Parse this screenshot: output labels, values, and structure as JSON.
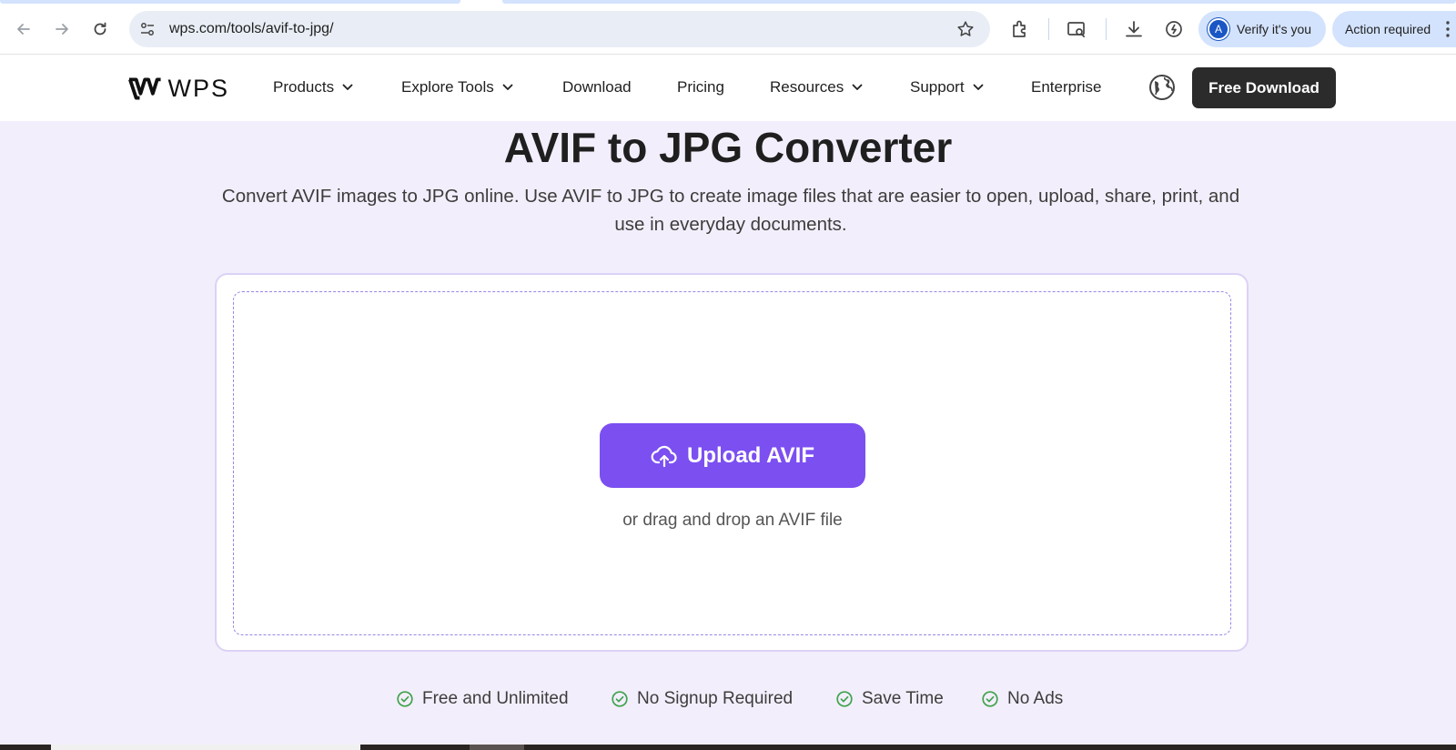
{
  "browser": {
    "url": "wps.com/tools/avif-to-jpg/",
    "profile_initial": "A",
    "verify_label": "Verify it's you",
    "action_label": "Action required"
  },
  "header": {
    "logo_text": "WPS",
    "nav": [
      {
        "label": "Products",
        "dropdown": true
      },
      {
        "label": "Explore Tools",
        "dropdown": true
      },
      {
        "label": "Download",
        "dropdown": false
      },
      {
        "label": "Pricing",
        "dropdown": false
      },
      {
        "label": "Resources",
        "dropdown": true
      },
      {
        "label": "Support",
        "dropdown": true
      },
      {
        "label": "Enterprise",
        "dropdown": false
      }
    ],
    "cta_label": "Free Download"
  },
  "main": {
    "title": "AVIF to JPG Converter",
    "description": "Convert AVIF images to JPG online. Use AVIF to JPG to create image files that are easier to open, upload, share, print, and use in everyday documents.",
    "upload_label": "Upload AVIF",
    "drag_hint": "or drag and drop an AVIF file",
    "features": [
      "Free and Unlimited",
      "No Signup Required",
      "Save Time",
      "No Ads"
    ]
  },
  "colors": {
    "accent": "#7c4ff1",
    "page_bg": "#f3eefb",
    "check": "#3fa34d",
    "cta_bg": "#2b2b2b"
  }
}
